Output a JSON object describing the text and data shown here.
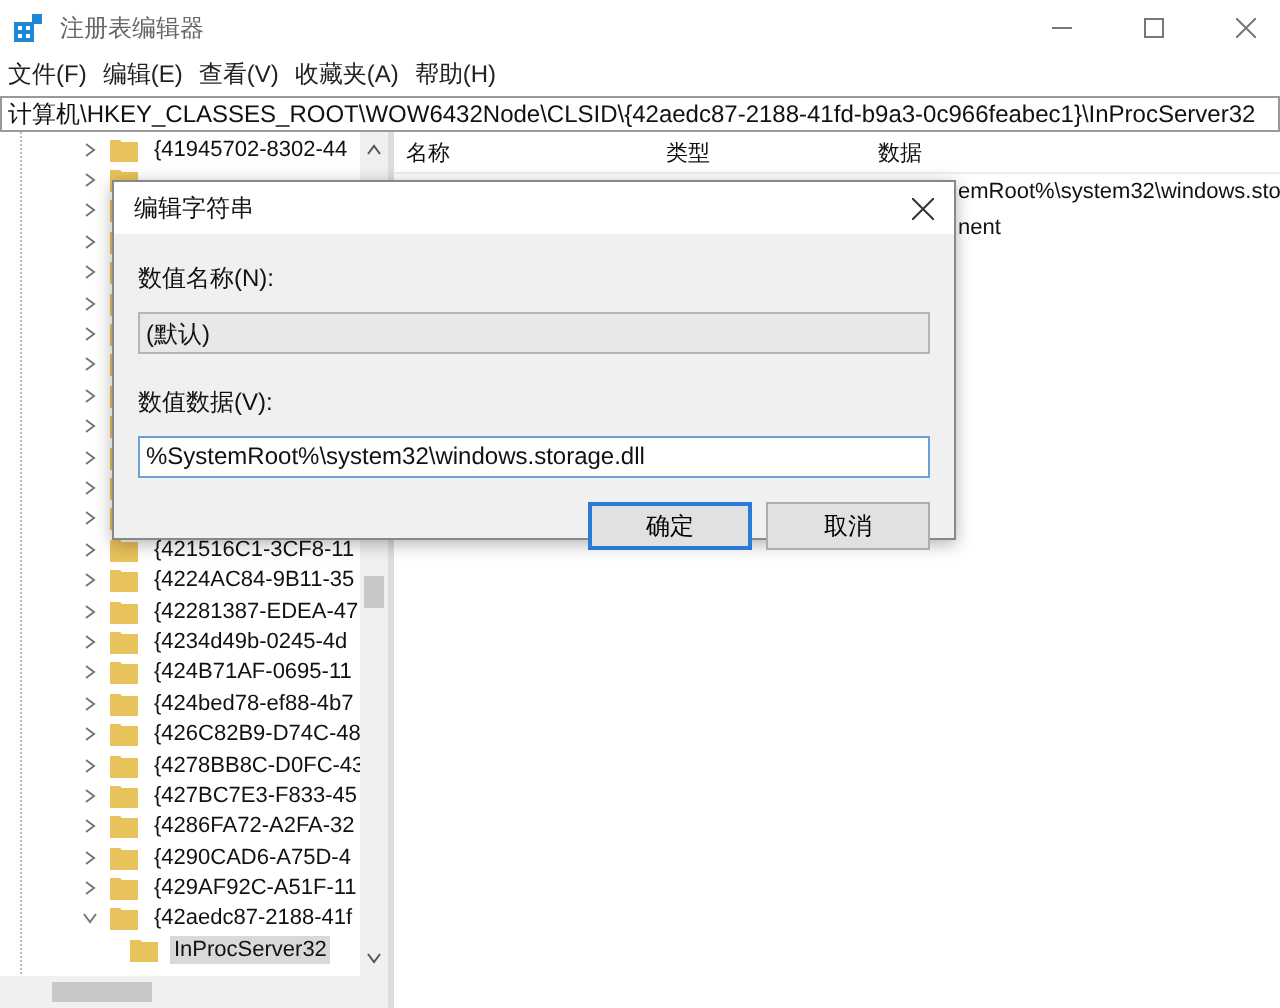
{
  "window": {
    "title": "注册表编辑器"
  },
  "menu": [
    "文件(F)",
    "编辑(E)",
    "查看(V)",
    "收藏夹(A)",
    "帮助(H)"
  ],
  "address": "计算机\\HKEY_CLASSES_ROOT\\WOW6432Node\\CLSID\\{42aedc87-2188-41fd-b9a3-0c966feabec1}\\InProcServer32",
  "tree_top": [
    {
      "label": "{41945702-8302-44",
      "expanded": false
    }
  ],
  "tree": [
    {
      "label": "{421516C1-3CF8-11",
      "expanded": false
    },
    {
      "label": "{4224AC84-9B11-35",
      "expanded": false
    },
    {
      "label": "{42281387-EDEA-47",
      "expanded": false
    },
    {
      "label": "{4234d49b-0245-4d",
      "expanded": false
    },
    {
      "label": "{424B71AF-0695-11",
      "expanded": false
    },
    {
      "label": "{424bed78-ef88-4b7",
      "expanded": false
    },
    {
      "label": "{426C82B9-D74C-48",
      "expanded": false
    },
    {
      "label": "{4278BB8C-D0FC-43",
      "expanded": false
    },
    {
      "label": "{427BC7E3-F833-45",
      "expanded": false
    },
    {
      "label": "{4286FA72-A2FA-32",
      "expanded": false
    },
    {
      "label": "{4290CAD6-A75D-4",
      "expanded": false
    },
    {
      "label": "{429AF92C-A51F-11",
      "expanded": false
    },
    {
      "label": "{42aedc87-2188-41f",
      "expanded": true,
      "children": [
        {
          "label": "InProcServer32",
          "selected": true
        }
      ]
    }
  ],
  "list": {
    "columns": [
      "名称",
      "类型",
      "数据"
    ],
    "rows": [
      {
        "data": "emRoot%\\system32\\windows.sto"
      },
      {
        "data": "nent"
      }
    ]
  },
  "dialog": {
    "title": "编辑字符串",
    "name_label": "数值名称(N):",
    "name_value": "(默认)",
    "data_label": "数值数据(V):",
    "data_value": "%SystemRoot%\\system32\\windows.storage.dll",
    "buttons": [
      {
        "label": "确定",
        "default": true
      },
      {
        "label": "取消",
        "default": false
      }
    ]
  }
}
